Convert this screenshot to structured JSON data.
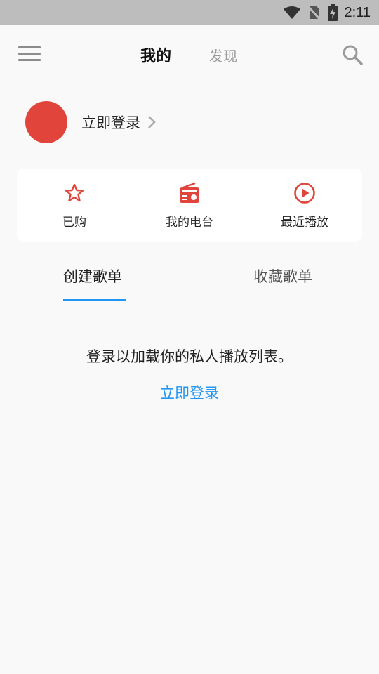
{
  "status_bar": {
    "time": "2:11",
    "icons": [
      "wifi-icon",
      "no-sim-icon",
      "battery-charging-icon"
    ]
  },
  "header": {
    "tab_mine": "我的",
    "tab_discover": "发现",
    "menu_icon": "hamburger-menu-icon",
    "search_icon": "search-icon"
  },
  "profile": {
    "login_label": "立即登录",
    "avatar_color": "#e0443a"
  },
  "quick_actions": [
    {
      "label": "已购",
      "icon": "star-icon"
    },
    {
      "label": "我的电台",
      "icon": "radio-icon"
    },
    {
      "label": "最近播放",
      "icon": "play-circle-icon"
    }
  ],
  "playlist_tabs": {
    "created": "创建歌单",
    "favorited": "收藏歌单",
    "active": "created"
  },
  "empty_state": {
    "message": "登录以加载你的私人播放列表。",
    "login_link": "立即登录"
  },
  "colors": {
    "accent_red": "#e0443a",
    "accent_blue": "#2196f3"
  }
}
